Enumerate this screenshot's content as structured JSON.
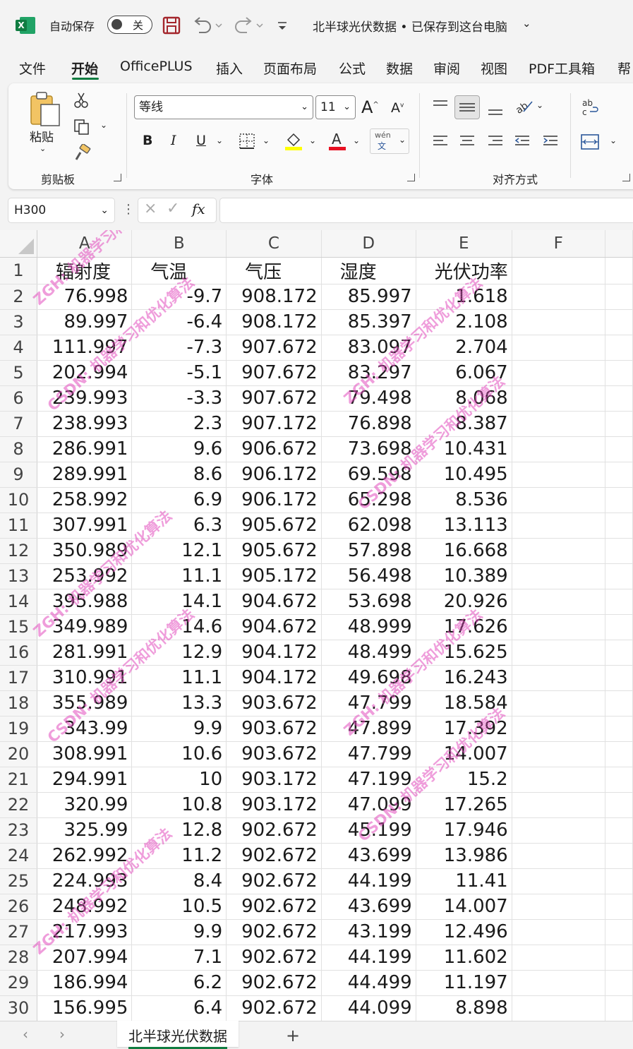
{
  "titlebar": {
    "autosave_label": "自动保存",
    "autosave_state": "关",
    "document_title": "北半球光伏数据 • 已保存到这台电脑"
  },
  "tabs": [
    "文件",
    "开始",
    "OfficePLUS",
    "插入",
    "页面布局",
    "公式",
    "数据",
    "审阅",
    "视图",
    "PDF工具箱",
    "帮"
  ],
  "ribbon": {
    "clipboard": {
      "paste_label": "粘贴",
      "group_label": "剪贴板"
    },
    "font": {
      "font_name": "等线",
      "font_size": "11",
      "group_label": "字体",
      "phonetic_top": "wén",
      "phonetic_bottom": "文"
    },
    "alignment": {
      "group_label": "对齐方式"
    }
  },
  "formula_bar": {
    "name_box": "H300",
    "fx_label": "fx",
    "formula": ""
  },
  "grid": {
    "columns": [
      "A",
      "B",
      "C",
      "D",
      "E",
      "F"
    ],
    "rows": [
      {
        "n": "1",
        "a": "辐射度",
        "b": "气温",
        "c": "气压",
        "d": "湿度",
        "e": "光伏功率"
      },
      {
        "n": "2",
        "a": "76.998",
        "b": "-9.7",
        "c": "908.172",
        "d": "85.997",
        "e": "1.618"
      },
      {
        "n": "3",
        "a": "89.997",
        "b": "-6.4",
        "c": "908.172",
        "d": "85.397",
        "e": "2.108"
      },
      {
        "n": "4",
        "a": "111.997",
        "b": "-7.3",
        "c": "907.672",
        "d": "83.097",
        "e": "2.704"
      },
      {
        "n": "5",
        "a": "202.994",
        "b": "-5.1",
        "c": "907.672",
        "d": "83.297",
        "e": "6.067"
      },
      {
        "n": "6",
        "a": "239.993",
        "b": "-3.3",
        "c": "907.672",
        "d": "79.498",
        "e": "8.068"
      },
      {
        "n": "7",
        "a": "238.993",
        "b": "2.3",
        "c": "907.172",
        "d": "76.898",
        "e": "8.387"
      },
      {
        "n": "8",
        "a": "286.991",
        "b": "9.6",
        "c": "906.672",
        "d": "73.698",
        "e": "10.431"
      },
      {
        "n": "9",
        "a": "289.991",
        "b": "8.6",
        "c": "906.172",
        "d": "69.598",
        "e": "10.495"
      },
      {
        "n": "10",
        "a": "258.992",
        "b": "6.9",
        "c": "906.172",
        "d": "65.298",
        "e": "8.536"
      },
      {
        "n": "11",
        "a": "307.991",
        "b": "6.3",
        "c": "905.672",
        "d": "62.098",
        "e": "13.113"
      },
      {
        "n": "12",
        "a": "350.989",
        "b": "12.1",
        "c": "905.672",
        "d": "57.898",
        "e": "16.668"
      },
      {
        "n": "13",
        "a": "253.992",
        "b": "11.1",
        "c": "905.172",
        "d": "56.498",
        "e": "10.389"
      },
      {
        "n": "14",
        "a": "395.988",
        "b": "14.1",
        "c": "904.672",
        "d": "53.698",
        "e": "20.926"
      },
      {
        "n": "15",
        "a": "349.989",
        "b": "14.6",
        "c": "904.672",
        "d": "48.999",
        "e": "17.626"
      },
      {
        "n": "16",
        "a": "281.991",
        "b": "12.9",
        "c": "904.172",
        "d": "48.499",
        "e": "15.625"
      },
      {
        "n": "17",
        "a": "310.991",
        "b": "11.1",
        "c": "904.172",
        "d": "49.698",
        "e": "16.243"
      },
      {
        "n": "18",
        "a": "355.989",
        "b": "13.3",
        "c": "903.672",
        "d": "47.799",
        "e": "18.584"
      },
      {
        "n": "19",
        "a": "343.99",
        "b": "9.9",
        "c": "903.672",
        "d": "47.899",
        "e": "17.392"
      },
      {
        "n": "20",
        "a": "308.991",
        "b": "10.6",
        "c": "903.672",
        "d": "47.799",
        "e": "14.007"
      },
      {
        "n": "21",
        "a": "294.991",
        "b": "10",
        "c": "903.172",
        "d": "47.199",
        "e": "15.2"
      },
      {
        "n": "22",
        "a": "320.99",
        "b": "10.8",
        "c": "903.172",
        "d": "47.099",
        "e": "17.265"
      },
      {
        "n": "23",
        "a": "325.99",
        "b": "12.8",
        "c": "902.672",
        "d": "45.199",
        "e": "17.946"
      },
      {
        "n": "24",
        "a": "262.992",
        "b": "11.2",
        "c": "902.672",
        "d": "43.699",
        "e": "13.986"
      },
      {
        "n": "25",
        "a": "224.993",
        "b": "8.4",
        "c": "902.672",
        "d": "44.199",
        "e": "11.41"
      },
      {
        "n": "26",
        "a": "248.992",
        "b": "10.5",
        "c": "902.672",
        "d": "43.699",
        "e": "14.007"
      },
      {
        "n": "27",
        "a": "217.993",
        "b": "9.9",
        "c": "902.672",
        "d": "43.199",
        "e": "12.496"
      },
      {
        "n": "28",
        "a": "207.994",
        "b": "7.1",
        "c": "902.672",
        "d": "44.199",
        "e": "11.602"
      },
      {
        "n": "29",
        "a": "186.994",
        "b": "6.2",
        "c": "902.672",
        "d": "44.499",
        "e": "11.197"
      },
      {
        "n": "30",
        "a": "156.995",
        "b": "6.4",
        "c": "902.672",
        "d": "44.099",
        "e": "8.898"
      }
    ]
  },
  "sheets": {
    "active": "北半球光伏数据",
    "add_label": "+"
  },
  "watermark": {
    "text_1": "ZGH: 机器学习和优化算法",
    "text_2": "CSDN: 机器学习和优化算法"
  },
  "icons": [
    "excel-logo-icon",
    "save-icon",
    "undo-icon",
    "redo-icon",
    "customize-icon",
    "paste-icon",
    "cut-icon",
    "copy-icon",
    "format-painter-icon",
    "bold-icon",
    "italic-icon",
    "underline-icon",
    "border-icon",
    "fill-color-icon",
    "font-color-icon",
    "align-icon",
    "wrap-icon"
  ],
  "colors": {
    "accent": "#107c41",
    "font_color_bar": "#e81123",
    "fill_color_bar": "#ffff00",
    "watermark": "#e24cbe"
  }
}
